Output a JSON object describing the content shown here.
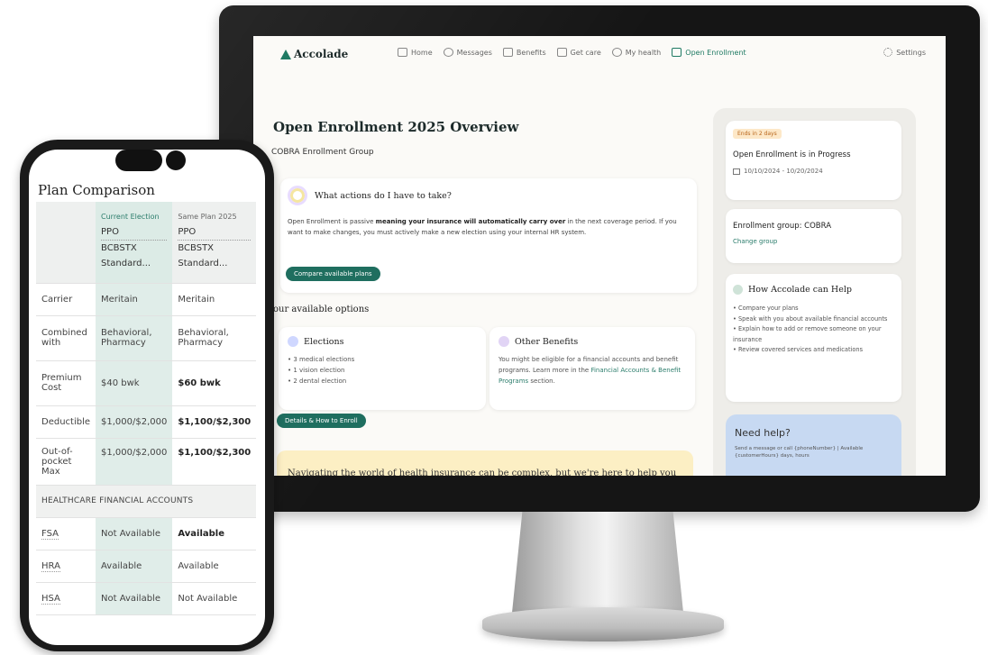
{
  "desktop": {
    "brand": "Accolade",
    "nav": [
      {
        "label": "Home",
        "icon": "home-icon"
      },
      {
        "label": "Messages",
        "icon": "chat-icon"
      },
      {
        "label": "Benefits",
        "icon": "grid-icon"
      },
      {
        "label": "Get care",
        "icon": "stethoscope-icon"
      },
      {
        "label": "My health",
        "icon": "heart-icon"
      },
      {
        "label": "Open Enrollment",
        "icon": "clipboard-icon"
      }
    ],
    "settings_label": "Settings",
    "title": "Open Enrollment 2025 Overview",
    "subtitle": "COBRA Enrollment Group",
    "actions": {
      "heading": "What actions do I have to take?",
      "text_pre": "Open Enrollment is passive ",
      "text_bold": "meaning your insurance will automatically carry over",
      "text_post": " in the next coverage period. If you want to make changes, you must actively make a new election using your internal HR system.",
      "button": "Compare available plans"
    },
    "options_title": "our available options",
    "elections": {
      "heading": "Elections",
      "items": [
        "3 medical elections",
        "1 vision election",
        "2 dental election"
      ]
    },
    "other_benefits": {
      "heading": "Other Benefits",
      "text": "You might be eligible for a financial accounts and benefit programs. Learn more in the ",
      "link": "Financial Accounts & Benefit Programs",
      "text_end": " section."
    },
    "details_button": "Details & How to Enroll",
    "banner": "Navigating the world of health insurance can be complex, but we're here to help you",
    "status": {
      "badge": "Ends in 2 days",
      "title": "Open Enrollment is in Progress",
      "dates": "10/10/2024 - 10/20/2024"
    },
    "group": {
      "title": "Enrollment group: COBRA",
      "link": "Change group"
    },
    "help": {
      "heading": "How Accolade can Help",
      "items": [
        "Compare your plans",
        "Speak with you about available financial accounts",
        "Explain how to add or remove someone on your insurance",
        "Review covered services and medications"
      ]
    },
    "need_help": {
      "title": "Need help?",
      "text": "Send a message or call {phoneNumber} | Available {customerHours} days, hours"
    }
  },
  "phone": {
    "title": "Plan Comparison",
    "columns": {
      "current": {
        "label": "Current Election",
        "plan": "PPO",
        "code": "BCBSTX",
        "name": "Standard..."
      },
      "same": {
        "label": "Same Plan 2025",
        "plan": "PPO",
        "code": "BCBSTX",
        "name": "Standard..."
      }
    },
    "rows": [
      {
        "label": "Carrier",
        "current": "Meritain",
        "same": "Meritain",
        "bold": false
      },
      {
        "label": "Combined with",
        "current": "Behavioral, Pharmacy",
        "same": "Behavioral, Pharmacy",
        "bold": false
      },
      {
        "label": "Premium Cost",
        "current": "$40 bwk",
        "same": "$60 bwk",
        "bold": true
      },
      {
        "label": "Deductible",
        "current": "$1,000/$2,000",
        "same": "$1,100/$2,300",
        "bold": true
      },
      {
        "label": "Out-of-pocket Max",
        "current": "$1,000/$2,000",
        "same": "$1,100/$2,300",
        "bold": true
      }
    ],
    "section": "HEALTHCARE FINANCIAL ACCOUNTS",
    "accounts": [
      {
        "label": "FSA",
        "current": "Not Available",
        "same": "Available",
        "bold": true
      },
      {
        "label": "HRA",
        "current": "Available",
        "same": "Available",
        "bold": false
      },
      {
        "label": "HSA",
        "current": "Not Available",
        "same": "Not Available",
        "bold": false
      }
    ]
  },
  "colors": {
    "brand_green": "#1f6e5f",
    "banner_yellow": "#fcefc4",
    "need_help_blue": "#c7d9f2",
    "current_col": "#e0ede9"
  }
}
